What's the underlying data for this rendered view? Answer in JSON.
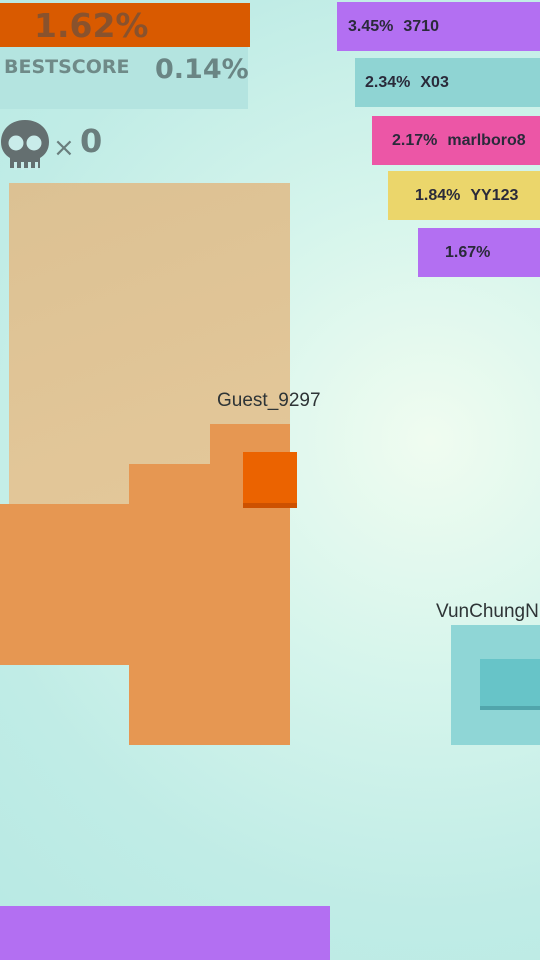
{
  "hud": {
    "score_percent": "1.62%",
    "best_score_label": "BESTSCORE",
    "best_score_value": "0.14%",
    "kills_symbol": "×",
    "kills_value": "0"
  },
  "leaderboard": [
    {
      "percent": "3.45%",
      "name": "3710",
      "color": "#b36ff2"
    },
    {
      "percent": "2.34%",
      "name": "X03",
      "color": "#8fd4d3"
    },
    {
      "percent": "2.17%",
      "name": "marlboro8",
      "color": "#ec56a6"
    },
    {
      "percent": "1.84%",
      "name": "YY123",
      "color": "#ebd66b"
    },
    {
      "percent": "1.67%",
      "name": "",
      "color": "#b36ff2"
    }
  ],
  "players": {
    "self": {
      "name": "Guest_9297",
      "territory_color": "#e69752",
      "trail_color": "#e1c191",
      "head_color": "#eb6300"
    },
    "other": {
      "name": "VunChungN",
      "territory_color": "#8fd6d6",
      "head_color": "#67c4c8"
    },
    "bottom_territory_color": "#b36ff2"
  },
  "icons": {
    "skull": "skull-icon"
  }
}
